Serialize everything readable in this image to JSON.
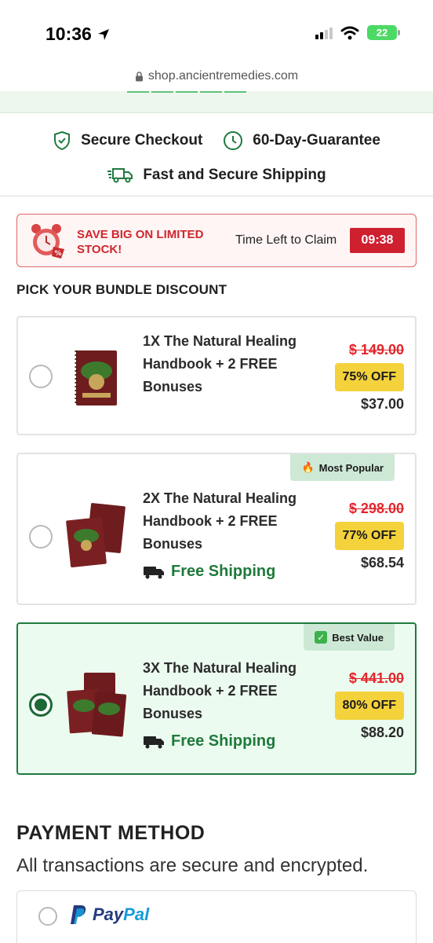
{
  "status_bar": {
    "time": "10:36",
    "battery": "22"
  },
  "browser": {
    "url": "shop.ancientremedies.com"
  },
  "trust_badges": {
    "secure_checkout": "Secure Checkout",
    "guarantee": "60-Day-Guarantee",
    "shipping": "Fast and Secure Shipping"
  },
  "sale_banner": {
    "headline": "SAVE BIG ON LIMITED STOCK!",
    "time_left_label": "Time Left to Claim",
    "timer": "09:38"
  },
  "bundle_section": {
    "heading": "PICK YOUR BUNDLE DISCOUNT",
    "bundles": [
      {
        "title": "1X The Natural Healing Handbook + 2 FREE Bonuses",
        "old_price": "$ 149.00",
        "discount": "75% OFF",
        "price": "$37.00",
        "free_shipping": "",
        "ribbon": "",
        "selected": false
      },
      {
        "title": "2X The Natural Healing Handbook + 2 FREE Bonuses",
        "old_price": "$ 298.00",
        "discount": "77% OFF",
        "price": "$68.54",
        "free_shipping": "Free Shipping",
        "ribbon": "Most Popular",
        "selected": false
      },
      {
        "title": "3X The Natural Healing Handbook + 2 FREE Bonuses",
        "old_price": "$ 441.00",
        "discount": "80% OFF",
        "price": "$88.20",
        "free_shipping": "Free Shipping",
        "ribbon": "Best Value",
        "selected": true
      }
    ]
  },
  "payment": {
    "heading": "PAYMENT METHOD",
    "subtext": "All transactions are secure and encrypted.",
    "option_pay": "Pay",
    "option_pal": "Pal"
  },
  "colors": {
    "accent_green": "#1e7a3f",
    "sale_red": "#cf2030",
    "discount_yellow": "#f4d23c",
    "selected_bg": "#ecfbf0"
  }
}
